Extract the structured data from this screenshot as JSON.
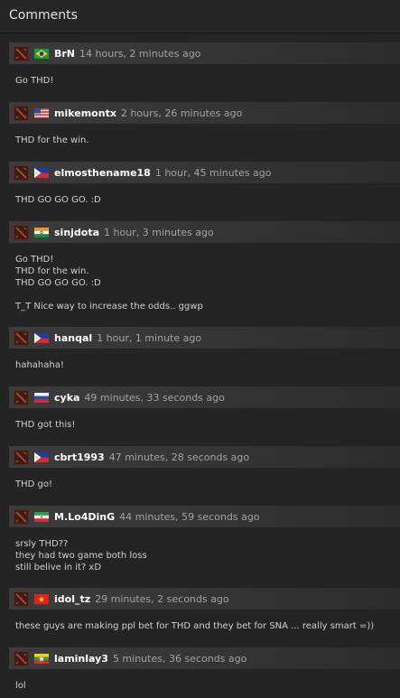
{
  "header": {
    "title": "Comments"
  },
  "comments": [
    {
      "username": "BrN",
      "flag": "brazil-flag",
      "time": "14 hours, 2 minutes ago",
      "body": "Go THD!"
    },
    {
      "username": "mikemontx",
      "flag": "usa-flag",
      "time": "2 hours, 26 minutes ago",
      "body": "THD for the win."
    },
    {
      "username": "elmosthename18",
      "flag": "philippines-flag",
      "time": "1 hour, 45 minutes ago",
      "body": "THD GO GO GO. :D"
    },
    {
      "username": "sinjdota",
      "flag": "india-flag",
      "time": "1 hour, 3 minutes ago",
      "body": "Go THD!\nTHD for the win.\nTHD GO GO GO. :D\n\nT_T Nice way to increase the odds.. ggwp"
    },
    {
      "username": "hanqal",
      "flag": "philippines-flag",
      "time": "1 hour, 1 minute ago",
      "body": "hahahaha!"
    },
    {
      "username": "cyka",
      "flag": "russia-flag",
      "time": "49 minutes, 33 seconds ago",
      "body": "THD got this!"
    },
    {
      "username": "cbrt1993",
      "flag": "philippines-flag",
      "time": "47 minutes, 28 seconds ago",
      "body": "THD go!"
    },
    {
      "username": "M.Lo4DinG",
      "flag": "iran-flag",
      "time": "44 minutes, 59 seconds ago",
      "body": "srsly THD??\nthey had two game both loss\nstill belive in it? xD"
    },
    {
      "username": "idol_tz",
      "flag": "vietnam-flag",
      "time": "29 minutes, 2 seconds ago",
      "body": "these guys are making ppl bet for THD and they bet for SNA ... really smart =))"
    },
    {
      "username": "laminlay3",
      "flag": "myanmar-flag",
      "time": "5 minutes, 36 seconds ago",
      "body": "lol"
    }
  ]
}
